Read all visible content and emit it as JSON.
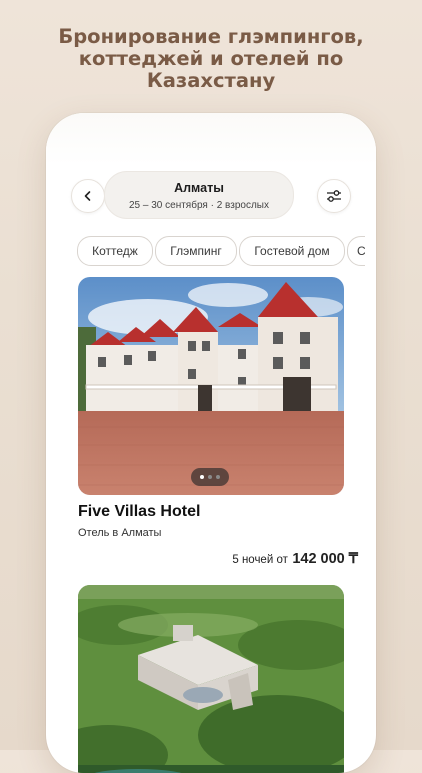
{
  "promo": {
    "line1": "Бронирование глэмпингов,",
    "line2": "коттеджей и отелей по",
    "line3": "Казахстану"
  },
  "search": {
    "city": "Алматы",
    "dates": "25 – 30 сентября · 2 взрослых"
  },
  "filters": [
    "Коттедж",
    "Глэмпинг",
    "Гостевой дом",
    "С"
  ],
  "listing": {
    "name": "Five Villas Hotel",
    "subtitle": "Отель в Алматы",
    "price_prefix": "5 ночей от",
    "price": "142 000 ₸",
    "photo_count": 3,
    "active_photo": 1
  },
  "icons": {
    "back": "chevron-left-icon",
    "filters": "sliders-icon"
  },
  "colors": {
    "headline": "#7a5b46",
    "background": "#efe4d9"
  }
}
